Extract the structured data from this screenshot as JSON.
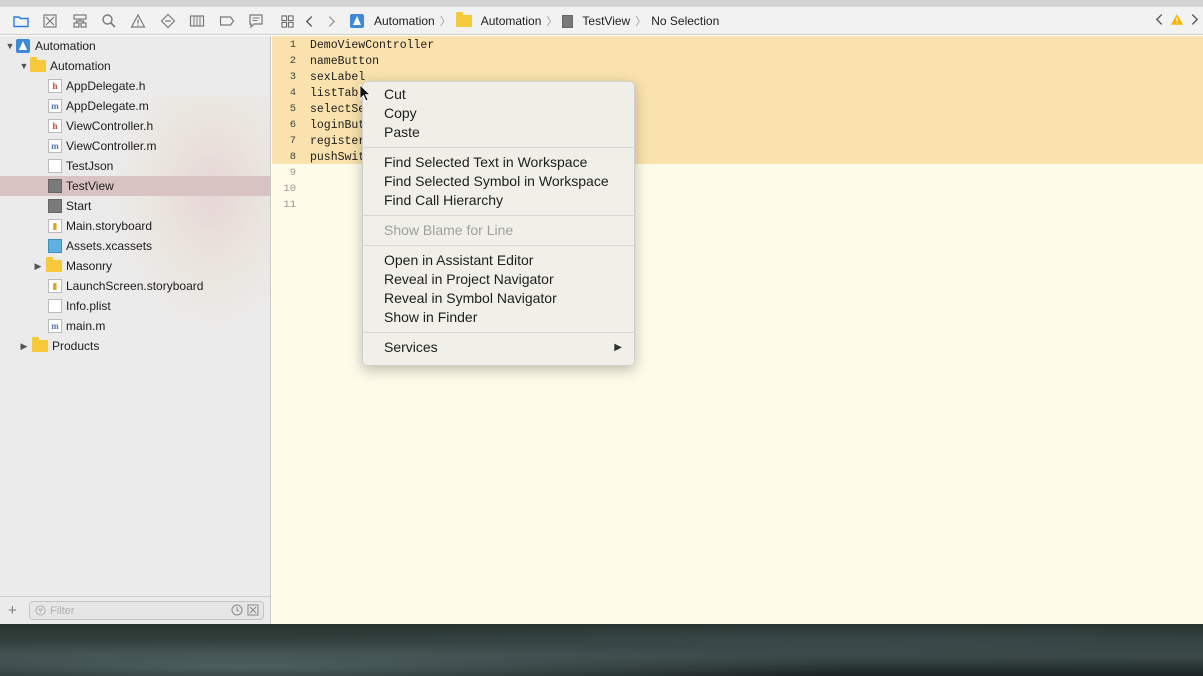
{
  "navigator_icons": [
    "folder-icon",
    "source-control-icon",
    "symbol-icon",
    "search-icon",
    "issue-icon",
    "test-icon",
    "debug-icon",
    "breakpoint-icon",
    "report-icon"
  ],
  "jumpbar": {
    "crumbs": [
      "Automation",
      "Automation",
      "TestView",
      "No Selection"
    ]
  },
  "tree": {
    "root": "Automation",
    "group": "Automation",
    "files": {
      "appdelegate_h": "AppDelegate.h",
      "appdelegate_m": "AppDelegate.m",
      "viewcontroller_h": "ViewController.h",
      "viewcontroller_m": "ViewController.m",
      "testjson": "TestJson",
      "testview": "TestView",
      "start": "Start",
      "main_storyboard": "Main.storyboard",
      "assets": "Assets.xcassets",
      "masonry": "Masonry",
      "launchscreen": "LaunchScreen.storyboard",
      "infoplist": "Info.plist",
      "main_m": "main.m"
    },
    "products": "Products"
  },
  "filter": {
    "placeholder": "Filter"
  },
  "editor": {
    "lines": [
      {
        "n": "1",
        "text": "DemoViewController"
      },
      {
        "n": "2",
        "text": "nameButton"
      },
      {
        "n": "3",
        "text": "sexLabel"
      },
      {
        "n": "4",
        "text": "listTab"
      },
      {
        "n": "5",
        "text": "selectSe"
      },
      {
        "n": "6",
        "text": "loginBut"
      },
      {
        "n": "7",
        "text": "register"
      },
      {
        "n": "8",
        "text": "pushSwit"
      },
      {
        "n": "9",
        "text": ""
      },
      {
        "n": "10",
        "text": ""
      },
      {
        "n": "11",
        "text": ""
      }
    ]
  },
  "context_menu": {
    "cut": "Cut",
    "copy": "Copy",
    "paste": "Paste",
    "find_text": "Find Selected Text in Workspace",
    "find_symbol": "Find Selected Symbol in Workspace",
    "find_hierarchy": "Find Call Hierarchy",
    "show_blame": "Show Blame for Line",
    "open_assistant": "Open in Assistant Editor",
    "reveal_project": "Reveal in Project Navigator",
    "reveal_symbol": "Reveal in Symbol Navigator",
    "show_finder": "Show in Finder",
    "services": "Services"
  },
  "colors": {
    "highlight_band": "#f9e2ad",
    "editor_bg": "#fefbe9",
    "selected_row": "#d9c2c2",
    "warning": "#f5b400"
  }
}
